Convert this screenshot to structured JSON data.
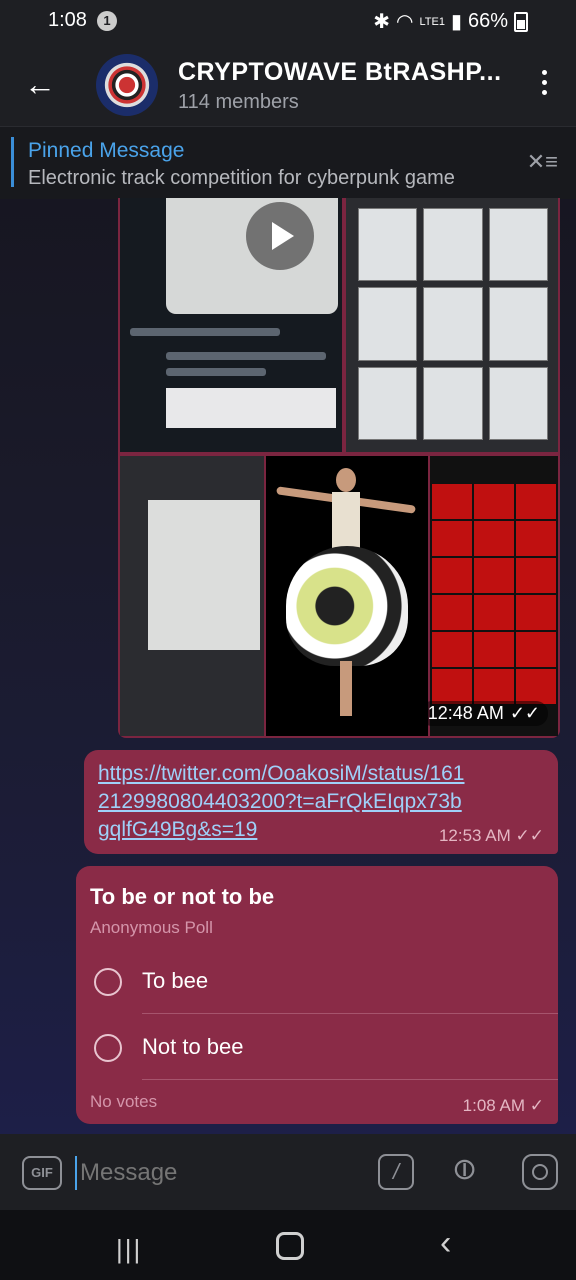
{
  "status": {
    "time": "1:08",
    "notif_count": "1",
    "battery": "66%",
    "network": "LTE1"
  },
  "header": {
    "title": "CRYPTOWAVE BtRASHP...",
    "members": "114 members"
  },
  "pinned": {
    "label": "Pinned Message",
    "text": "Electronic track competition for cyberpunk game"
  },
  "album": {
    "time": "12:48 AM"
  },
  "link_message": {
    "url": "https://twitter.com/OoakosiM/status/1612129980804403200?t=aFrQkEIqpx73bgqlfG49Bg&s=19",
    "time": "12:53 AM"
  },
  "poll": {
    "question": "To be or not to be",
    "type": "Anonymous Poll",
    "options": [
      {
        "label": "To bee"
      },
      {
        "label": "Not to bee"
      }
    ],
    "votes": "No votes",
    "time": "1:08 AM"
  },
  "composer": {
    "placeholder": "Message",
    "gif_label": "GIF"
  },
  "colors": {
    "bubble": "#8a2b47",
    "link": "#9fd0f8",
    "accent": "#4aa3ea"
  }
}
